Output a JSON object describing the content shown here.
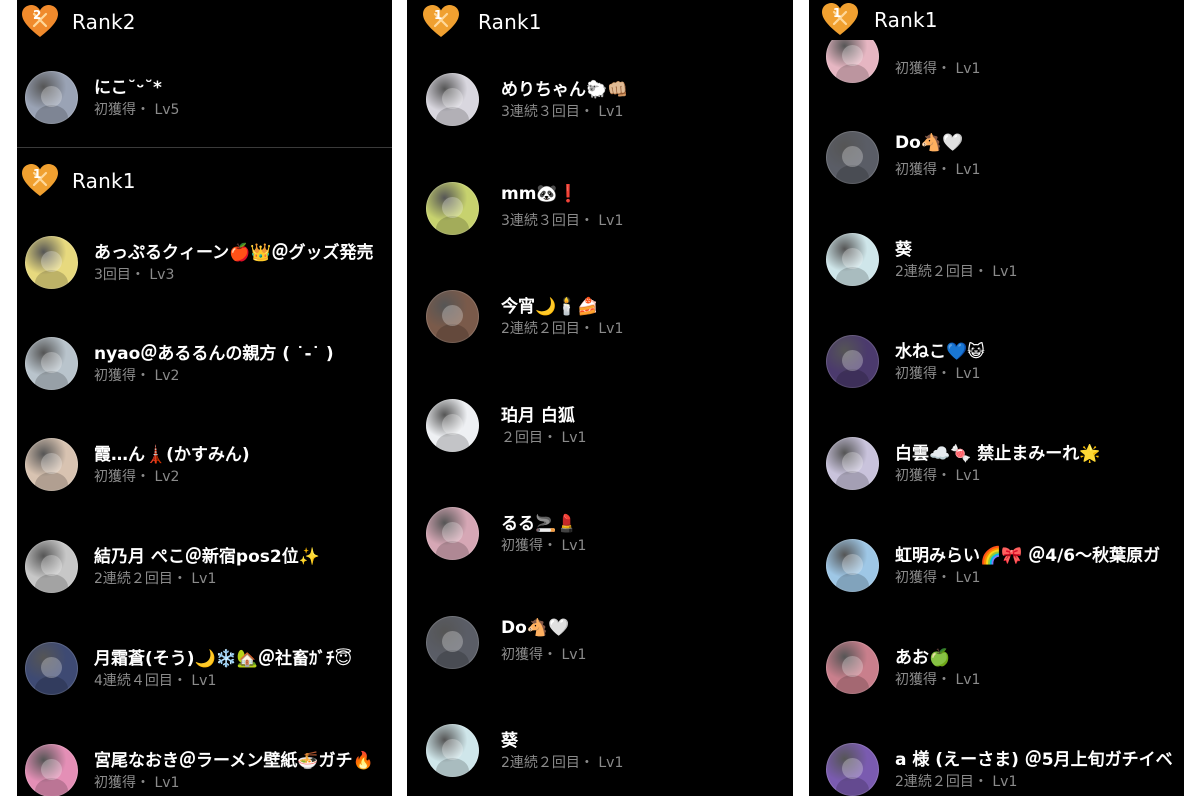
{
  "panels": [
    {
      "sections": [
        {
          "rank": "Rank2",
          "badge": "2",
          "badge_color": "#f08a2c",
          "entries": [
            {
              "name": "にこ˘ᵕ˘*",
              "sub": "初獲得・ Lv5",
              "avatar_color": "#9aa3b5"
            }
          ]
        },
        {
          "rank": "Rank1",
          "badge": "1",
          "badge_color": "#f0a030",
          "entries": [
            {
              "name": "あっぷるクィーン🍎👑＠グッズ発売",
              "sub": "3回目・ Lv3",
              "avatar_color": "#e7d97e"
            },
            {
              "name": "nyao＠あるるんの親方 ( ˙-˙ )",
              "sub": "初獲得・ Lv2",
              "avatar_color": "#b9c4cc"
            },
            {
              "name": "霞…ん🗼(かすみん)",
              "sub": "初獲得・ Lv2",
              "avatar_color": "#d8c3b1"
            },
            {
              "name": "結乃月 ぺこ＠新宿pos2位✨",
              "sub": "2連続２回目・ Lv1",
              "avatar_color": "#c7c7c7"
            },
            {
              "name": "月霜蒼(そう)🌙❄️🏡＠社畜ｶﾞﾁ😇",
              "sub": "4連続４回目・ Lv1",
              "avatar_color": "#3e4a73"
            },
            {
              "name": "宮尾なおき＠ラーメン壁紙🍜ガチ🔥",
              "sub": "初獲得・ Lv1",
              "avatar_color": "#e48fb6"
            }
          ]
        }
      ]
    },
    {
      "sections": [
        {
          "rank": "Rank1",
          "badge": "1",
          "badge_color": "#f0a030",
          "entries": [
            {
              "name": "めりちゃん🐑👊🏼",
              "sub": "3連続３回目・ Lv1",
              "avatar_color": "#d9d7df"
            },
            {
              "name": "mm🐼❗️",
              "sub": "3連続３回目・ Lv1",
              "avatar_color": "#c7d26e"
            },
            {
              "name": "今宵🌙🕯️🍰",
              "sub": "2連続２回目・ Lv1",
              "avatar_color": "#7a5a4a"
            },
            {
              "name": "珀月 白狐",
              "sub": "２回目・ Lv1",
              "avatar_color": "#eef0f3"
            },
            {
              "name": "るる🚬💄",
              "sub": "初獲得・ Lv1",
              "avatar_color": "#d6a7b5"
            },
            {
              "name": "Do🐴🤍",
              "sub": "初獲得・ Lv1",
              "avatar_color": "#5a5d66"
            },
            {
              "name": "葵",
              "sub": "2連続２回目・ Lv1",
              "avatar_color": "#cfe6ea"
            }
          ]
        }
      ]
    },
    {
      "sections": [
        {
          "rank": "Rank1",
          "badge": "1",
          "badge_color": "#f0a030",
          "entries": [
            {
              "name": "",
              "sub": "初獲得・ Lv1",
              "avatar_color": "#e6b6c2"
            },
            {
              "name": "Do🐴🤍",
              "sub": "初獲得・ Lv1",
              "avatar_color": "#5a5d66"
            },
            {
              "name": "葵",
              "sub": "2連続２回目・ Lv1",
              "avatar_color": "#cfe6ea"
            },
            {
              "name": "水ねこ💙😺",
              "sub": "初獲得・ Lv1",
              "avatar_color": "#4b3a6d"
            },
            {
              "name": "白雲☁️🍬 禁止まみーれ🌟",
              "sub": "初獲得・ Lv1",
              "avatar_color": "#c9c3dc"
            },
            {
              "name": "虹明みらい🌈🎀 ＠4/6〜秋葉原ガ",
              "sub": "初獲得・ Lv1",
              "avatar_color": "#9ec7e6"
            },
            {
              "name": "あお🍏",
              "sub": "初獲得・ Lv1",
              "avatar_color": "#c97f8c"
            },
            {
              "name": "a 様 (えーさま) ＠5月上旬ガチイベ",
              "sub": "2連続２回目・ Lv1",
              "avatar_color": "#7a5bb0"
            }
          ]
        }
      ]
    }
  ]
}
